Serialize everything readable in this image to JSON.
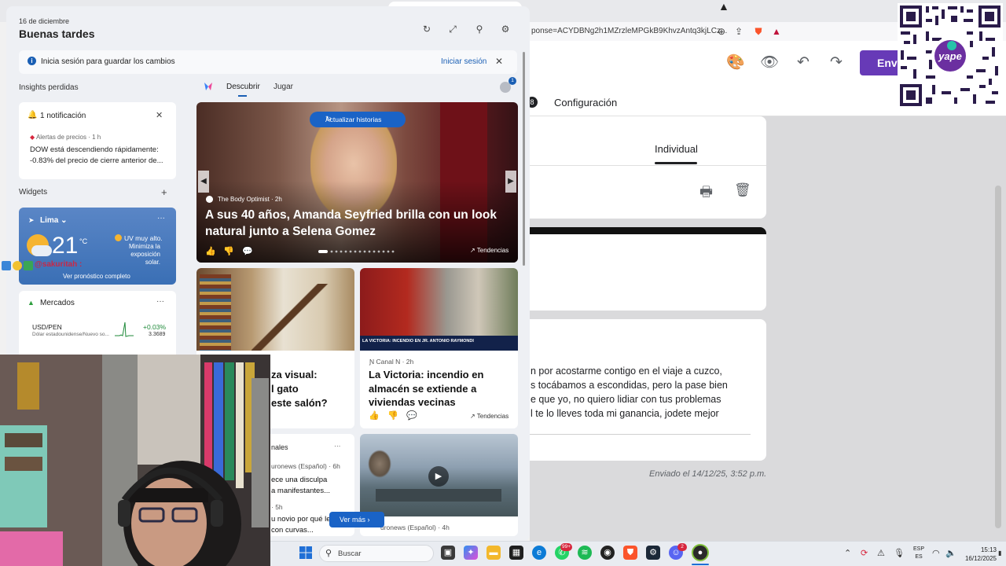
{
  "browser": {
    "url": "ponse=ACYDBNg2h1MZrzleMPGkB9KhvzAntq3kjLCz...",
    "send_label": "Env"
  },
  "form": {
    "tab_number": "8",
    "tab_config": "Configuración",
    "tab_individual": "Individual",
    "message_lines": [
      "n por acostarme contigo en el viaje a cuzco,",
      "s tocábamos a escondidas, pero la pase bien",
      "e que yo, no quiero lidiar con tus problemas",
      "l te lo lleves toda mi ganancia, jodete mejor"
    ],
    "sent_at": "Enviado el 14/12/25, 3:52 p.m."
  },
  "qr": {
    "brand": "yape"
  },
  "widgets": {
    "date": "16 de diciembre",
    "greeting": "Buenas tardes",
    "signin_text": "Inicia sesión para guardar los cambios",
    "signin_link": "Iniciar sesión",
    "insights_label": "Insights perdidas",
    "notification": {
      "title": "1 notificación",
      "source": "Alertas de precios · 1 h",
      "body": "DOW está descendiendo rápidamente: -0.83% del precio de cierre anterior de..."
    },
    "widgets_label": "Widgets",
    "weather": {
      "location": "Lima",
      "temp": "21",
      "unit": "°C",
      "uv_title": "UV muy alto.",
      "uv_detail": "Minimiza la exposición solar.",
      "forecast_link": "Ver pronóstico completo"
    },
    "overlay_tag": "@sakuritah :",
    "markets": {
      "title": "Mercados",
      "symbol": "USD/PEN",
      "name": "Dólar estadounidense/Nuevo so...",
      "change": "+0.03%",
      "value": "3.3689"
    },
    "tabs": [
      "Descubrir",
      "Jugar"
    ],
    "avatar_badge": "1",
    "hero": {
      "refresh": "Actualizar historias",
      "source": "The Body Optimist · 2h",
      "title": "A sus 40 años, Amanda Seyfried brilla con un look natural junto a Selena Gomez",
      "trend": "Tendencias"
    },
    "card_left": {
      "title_lines": [
        "za visual:",
        "l gato",
        "este salón?"
      ]
    },
    "card_right": {
      "source": "Canal N · 2h",
      "title": "La Victoria: incendio en almacén se extiende a viviendas vecinas",
      "trend": "Tendencias",
      "banner": "LA VICTORIA: INCENDIO EN JR. ANTONIO RAYMONDI"
    },
    "card_bottom_left": {
      "header": "nales",
      "source": "uronews (Español) · 6h",
      "lines": [
        "ece una disculpa",
        "a manifestantes..."
      ],
      "source2": "· 5h",
      "lines2": [
        "u novio por qué le",
        "con curvas..."
      ]
    },
    "card_bottom_right": {
      "source": "uronews (Español) · 4h"
    },
    "see_more": "Ver más"
  },
  "taskbar": {
    "search_placeholder": "Buscar",
    "badge_whatsapp": "99+",
    "badge_discord": "2",
    "lang_top": "ESP",
    "lang_bottom": "ES",
    "time": "15:13",
    "date": "16/12/2025"
  }
}
